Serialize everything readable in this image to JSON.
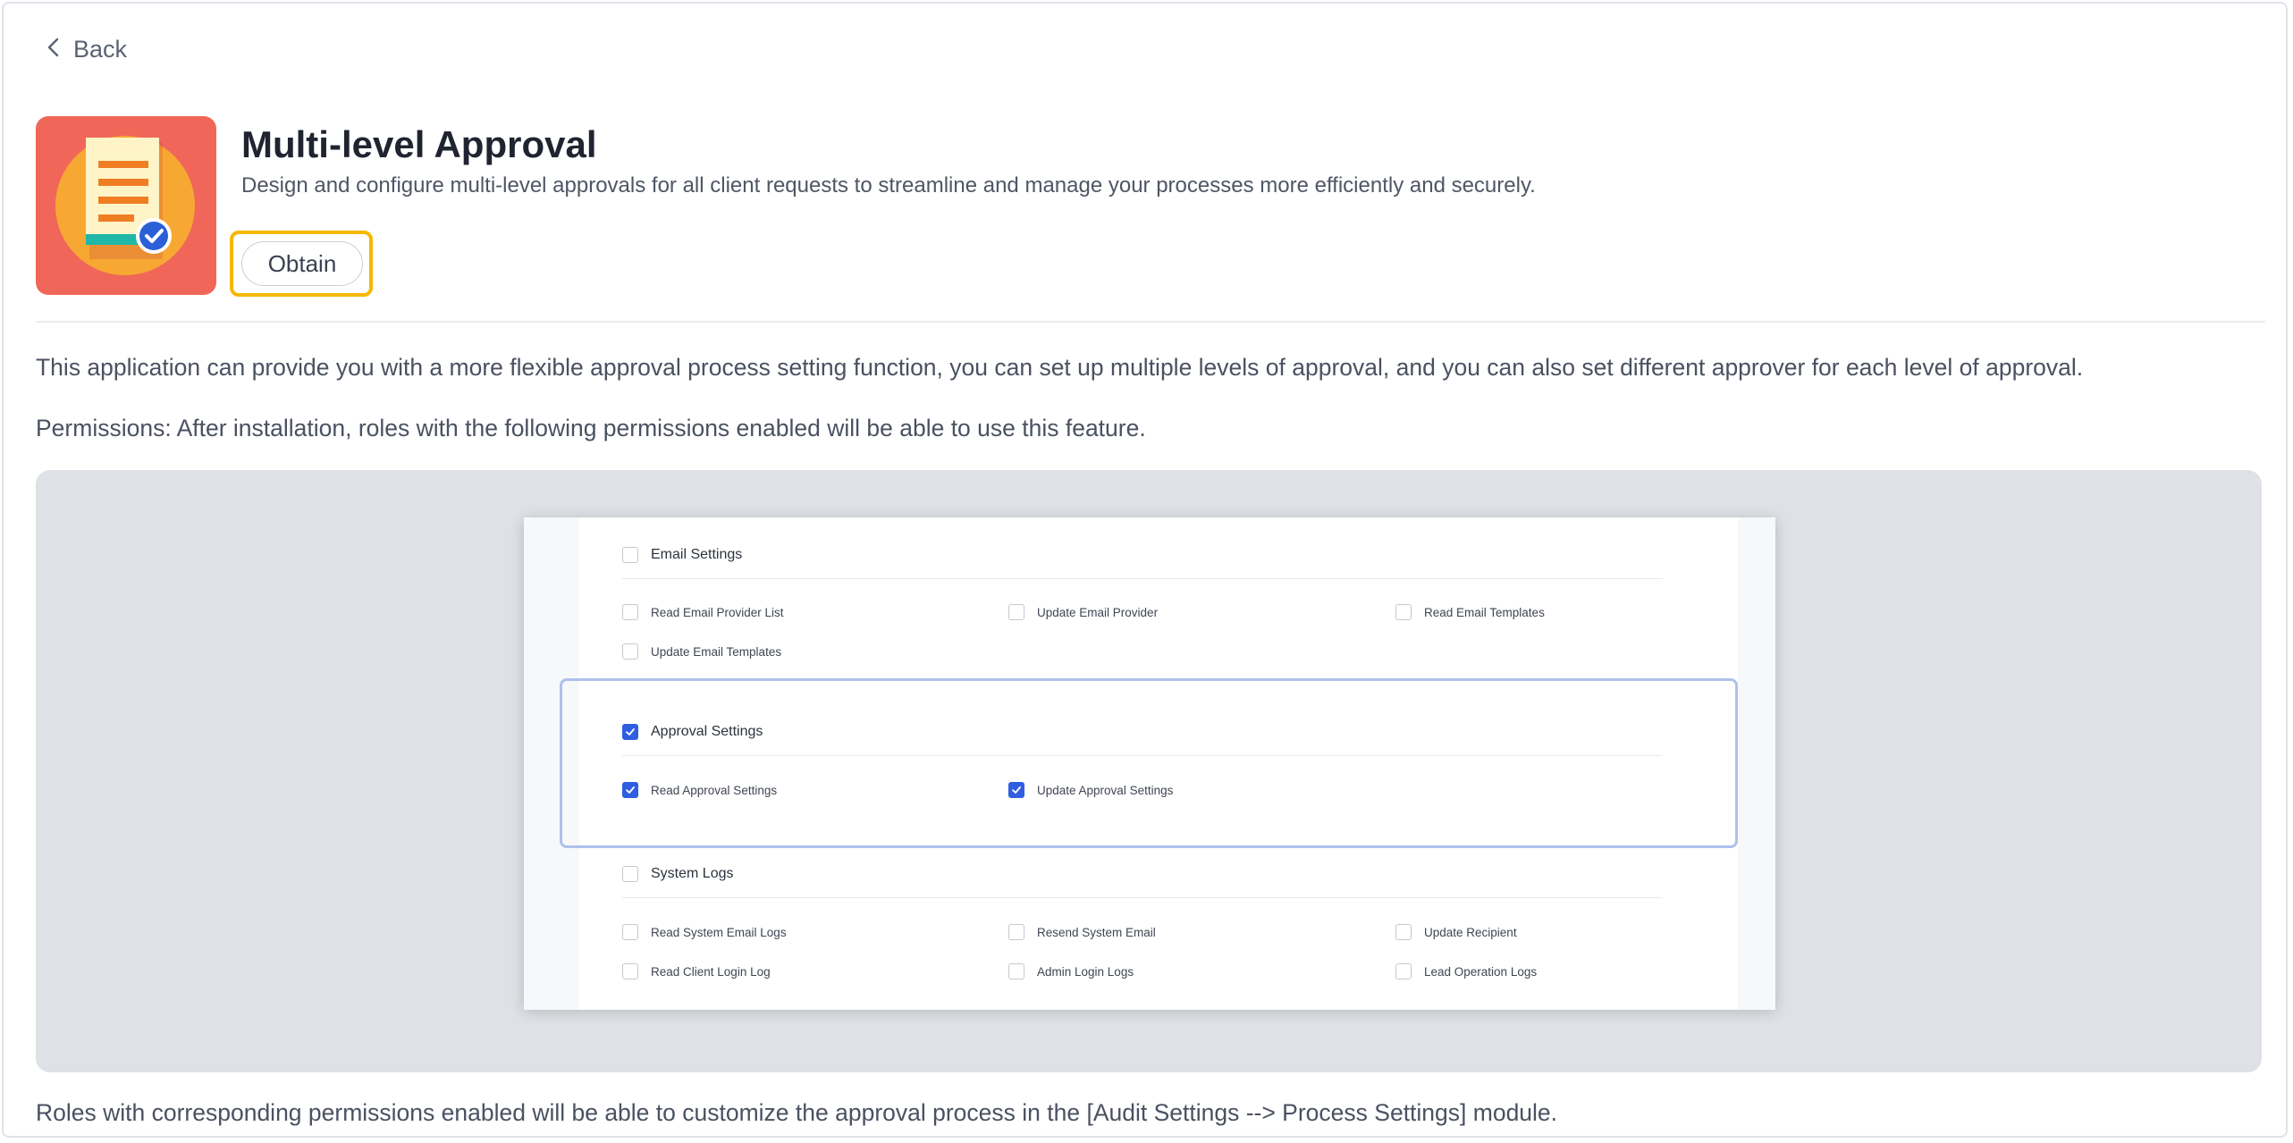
{
  "nav": {
    "back_label": "Back"
  },
  "app": {
    "title": "Multi-level Approval",
    "subtitle": "Design and configure multi-level approvals for all client requests to streamline and manage your processes more efficiently and securely.",
    "obtain_label": "Obtain",
    "icon": "document-approval-icon",
    "icon_bg_color": "#f0675a",
    "highlight_color": "#f5b800"
  },
  "content": {
    "description": "This application can provide you with a more flexible approval process setting function, you can set up multiple levels of approval, and you can also set different approver for each level of approval.",
    "permissions_note": "Permissions: After installation, roles with the following permissions enabled will be able to use this feature.",
    "footer_note": "Roles with corresponding permissions enabled will be able to customize the approval process in the [Audit Settings --> Process Settings] module."
  },
  "permissions_screenshot": {
    "accent_color": "#2f5ee0",
    "sections": [
      {
        "label": "Email Settings",
        "checked": false,
        "items": [
          {
            "label": "Read Email Provider List",
            "checked": false
          },
          {
            "label": "Update Email Provider",
            "checked": false
          },
          {
            "label": "Read Email Templates",
            "checked": false
          },
          {
            "label": "Update Email Templates",
            "checked": false
          }
        ]
      },
      {
        "label": "Approval Settings",
        "checked": true,
        "items": [
          {
            "label": "Read Approval Settings",
            "checked": true
          },
          {
            "label": "Update Approval Settings",
            "checked": true
          }
        ]
      },
      {
        "label": "System Logs",
        "checked": false,
        "items": [
          {
            "label": "Read System Email Logs",
            "checked": false
          },
          {
            "label": "Resend System Email",
            "checked": false
          },
          {
            "label": "Update Recipient",
            "checked": false
          },
          {
            "label": "Read Client Login Log",
            "checked": false
          },
          {
            "label": "Admin Login Logs",
            "checked": false
          },
          {
            "label": "Lead Operation Logs",
            "checked": false
          }
        ]
      }
    ]
  }
}
